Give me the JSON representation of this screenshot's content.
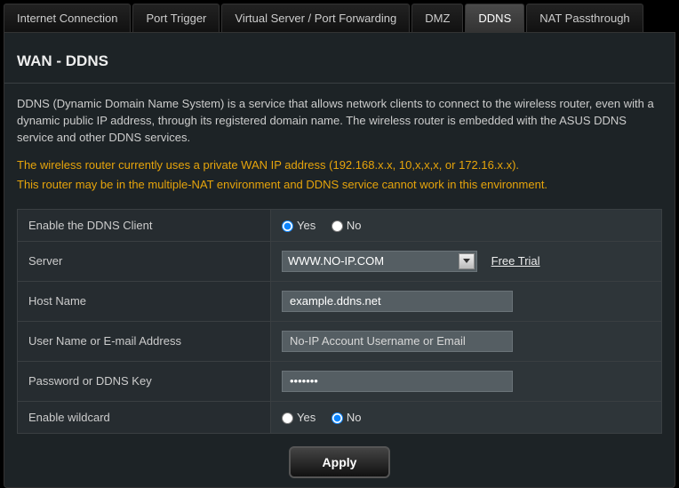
{
  "tabs": {
    "internet_connection": "Internet Connection",
    "port_trigger": "Port Trigger",
    "virtual_server": "Virtual Server / Port Forwarding",
    "dmz": "DMZ",
    "ddns": "DDNS",
    "nat_passthrough": "NAT Passthrough"
  },
  "page": {
    "title": "WAN - DDNS",
    "description": "DDNS (Dynamic Domain Name System) is a service that allows network clients to connect to the wireless router, even with a dynamic public IP address, through its registered domain name. The wireless router is embedded with the ASUS DDNS service and other DDNS services.",
    "warning1": "The wireless router currently uses a private WAN IP address (192.168.x.x, 10,x,x,x, or 172.16.x.x).",
    "warning2": "This router may be in the multiple-NAT environment and DDNS service cannot work in this environment."
  },
  "form": {
    "enable_client_label": "Enable the DDNS Client",
    "yes": "Yes",
    "no": "No",
    "enable_client_value": "yes",
    "server_label": "Server",
    "server_value": "WWW.NO-IP.COM",
    "free_trial": "Free Trial",
    "hostname_label": "Host Name",
    "hostname_value": "example.ddns.net",
    "username_label": "User Name or E-mail Address",
    "username_placeholder": "No-IP Account Username or Email",
    "username_value": "",
    "password_label": "Password or DDNS Key",
    "password_value": "•••••••",
    "wildcard_label": "Enable wildcard",
    "wildcard_value": "no"
  },
  "buttons": {
    "apply": "Apply"
  }
}
